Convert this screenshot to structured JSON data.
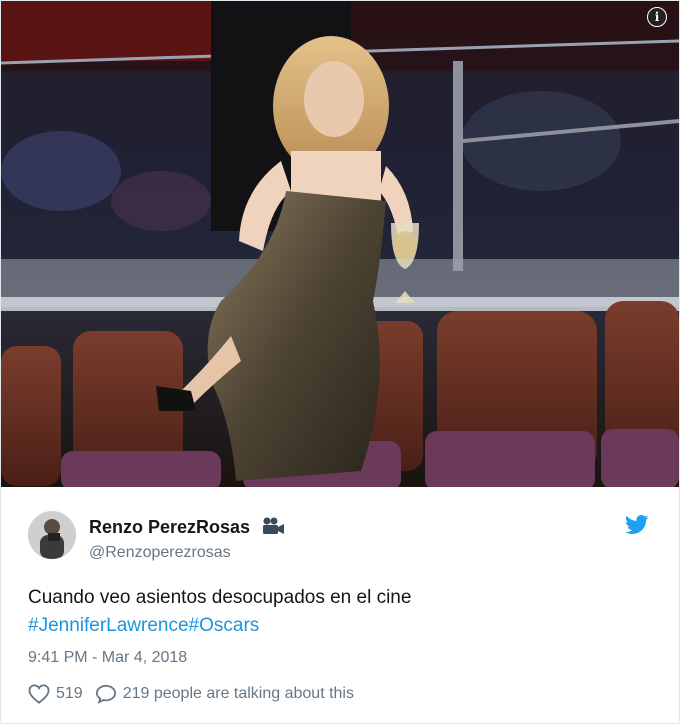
{
  "tweet": {
    "display_name": "Renzo PerezRosas",
    "handle": "@Renzoperezrosas",
    "text": "Cuando veo asientos desocupados en el cine",
    "hashtags": [
      "#JenniferLawrence",
      "#Oscars"
    ],
    "timestamp": "9:41 PM - Mar 4, 2018",
    "likes": "519",
    "talking": "219 people are talking about this"
  },
  "icons": {
    "info": "info-icon",
    "camera": "movie-camera-icon",
    "bird": "twitter-bird-icon",
    "heart": "heart-icon",
    "reply": "speech-bubble-icon"
  },
  "colors": {
    "link": "#1b95e0",
    "muted": "#657786",
    "text": "#14171a",
    "brand": "#1da1f2"
  }
}
